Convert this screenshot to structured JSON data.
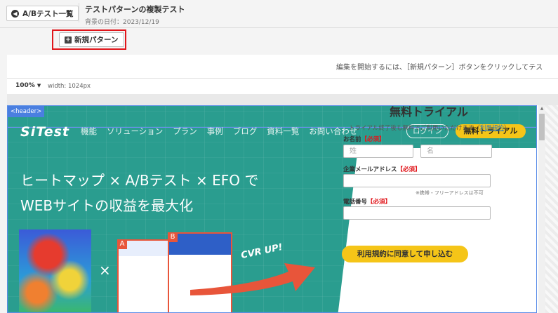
{
  "topbar": {
    "back_label": "A/Bテスト一覧",
    "title": "テストパターンの複製テスト",
    "subtitle": "背景の日付：2023/12/19"
  },
  "toolbar": {
    "new_pattern_label": "新規パターン"
  },
  "editor": {
    "message": "編集を開始するには、［新規パターン］ボタンをクリックしてテス",
    "zoom": "100%",
    "width_label": "width: 1024px",
    "header_tag": "<header>"
  },
  "site": {
    "logo": "SiTest",
    "nav": [
      "機能",
      "ソリューション",
      "プラン",
      "事例",
      "ブログ",
      "資料一覧",
      "お問い合わせ"
    ],
    "login_label": "ログイン",
    "trial_label": "無料トライアル",
    "hero_line1": "ヒートマップ × A/Bテスト × EFO で",
    "hero_line2": "WEBサイトの収益を最大化",
    "times": "×",
    "badge_a": "A",
    "badge_b": "B",
    "cvr": "CVR UP!"
  },
  "form": {
    "title": "無料トライアル",
    "note_prefix": "トライアル終了後も無料でご利用いただけます（",
    "note_link": "利用規約",
    "note_suffix": "）",
    "name_label": "お名前",
    "required": "【必須】",
    "last_name_placeholder": "姓",
    "first_name_placeholder": "名",
    "email_label": "企業メールアドレス",
    "email_hint": "※携帯・フリーアドレスは不可",
    "phone_label": "電話番号",
    "submit_label": "利用規約に同意して申し込む"
  }
}
